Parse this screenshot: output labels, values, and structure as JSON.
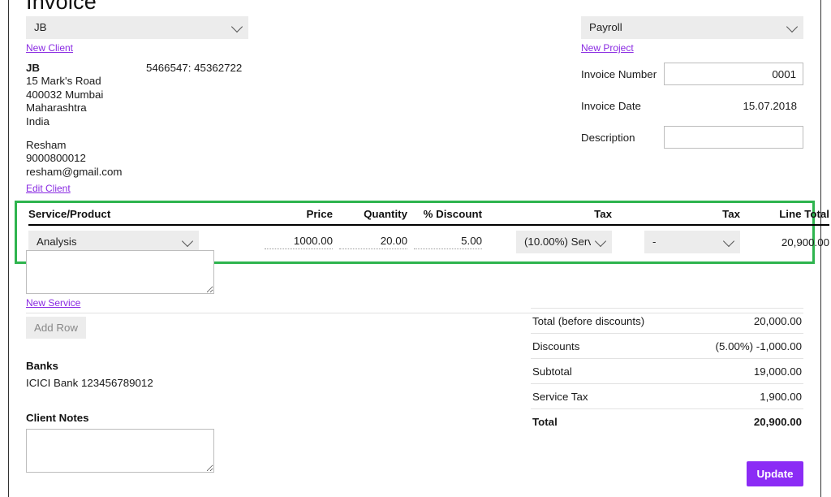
{
  "page": {
    "title": "Invoice",
    "accent_purple": "#8b2cf5",
    "link_purple": "#8a2be2",
    "highlight_green": "#2eb44e"
  },
  "client_panel": {
    "selected_client": "JB",
    "new_client_link": "New Client",
    "edit_client_link": "Edit Client",
    "name": "JB",
    "address_line1": "15 Mark's Road",
    "address_line2": "400032 Mumbai",
    "address_line3": "Maharashtra",
    "address_line4": "India",
    "registration": "5466547: 45362722",
    "contact_name": "Resham",
    "contact_phone": "9000800012",
    "contact_email": "resham@gmail.com"
  },
  "project_panel": {
    "selected_project": "Payroll",
    "new_project_link": "New Project",
    "invoice_number_label": "Invoice Number",
    "invoice_number_value": "0001",
    "invoice_date_label": "Invoice Date",
    "invoice_date_value": "15.07.2018",
    "description_label": "Description",
    "description_value": "",
    "description_placeholder": ""
  },
  "items_table": {
    "headers": {
      "service": "Service/Product",
      "price": "Price",
      "quantity": "Quantity",
      "discount": "% Discount",
      "tax1": "Tax",
      "tax2": "Tax",
      "line_total": "Line Total"
    },
    "rows": [
      {
        "service": "Analysis",
        "price": "1000.00",
        "quantity": "20.00",
        "discount": "5.00",
        "tax1": "(10.00%) Serv",
        "tax2": "-",
        "line_total": "20,900.00"
      }
    ],
    "service_note_value": "",
    "new_service_link": "New Service",
    "add_row_label": "Add Row"
  },
  "banks": {
    "heading": "Banks",
    "value": "ICICI Bank 123456789012"
  },
  "client_notes": {
    "heading": "Client Notes",
    "value": "",
    "placeholder": ""
  },
  "totals": {
    "rows": [
      {
        "label": "Total (before discounts)",
        "value": "20,000.00"
      },
      {
        "label": "Discounts",
        "value": "(5.00%) -1,000.00"
      },
      {
        "label": "Subtotal",
        "value": "19,000.00"
      },
      {
        "label": "Service Tax",
        "value": "1,900.00"
      }
    ],
    "grand": {
      "label": "Total",
      "value": "20,900.00"
    }
  },
  "actions": {
    "update_label": "Update"
  }
}
